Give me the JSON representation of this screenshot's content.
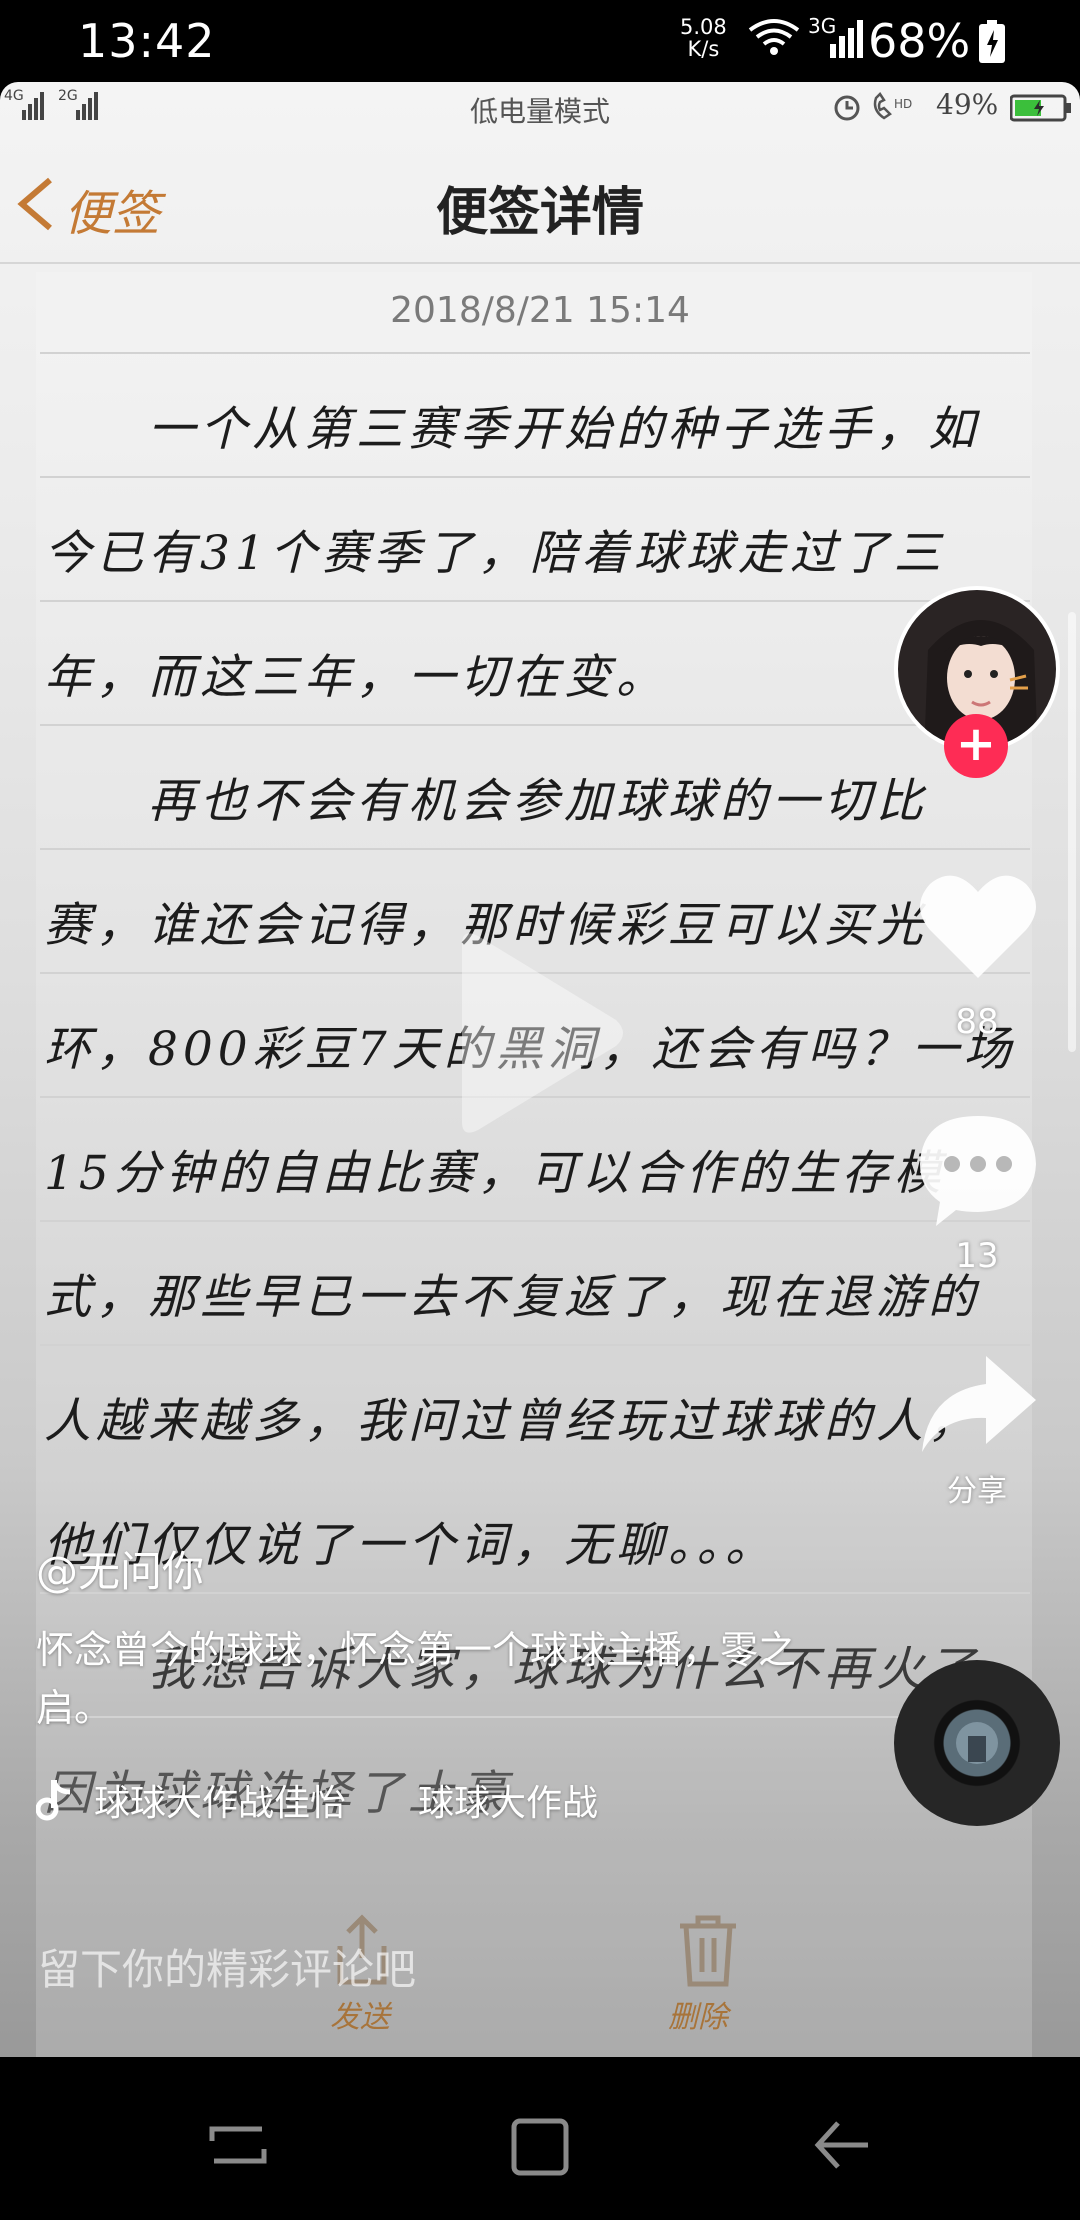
{
  "status_bar": {
    "time": "13:42",
    "network_speed_value": "5.08",
    "network_speed_unit": "K/s",
    "network_type": "3G",
    "battery_percent": "68%",
    "icons": [
      "wifi-icon",
      "signal-icon",
      "battery-icon"
    ]
  },
  "video": {
    "photo_status": {
      "signal_left": "4G",
      "signal_right": "2G",
      "mode_label": "低电量模式",
      "battery_percent": "49%",
      "icons": [
        "alarm-icon",
        "hd-call-icon"
      ]
    },
    "photo_header": {
      "back_label": "便签",
      "title": "便签详情"
    },
    "memo": {
      "date": "2018/8/21 15:14",
      "lines": [
        "　　一个从第三赛季开始的种子选手，如",
        "今已有31个赛季了，陪着球球走过了三",
        "年，而这三年，一切在变。",
        "　　再也不会有机会参加球球的一切比",
        "赛，谁还会记得，那时候彩豆可以买光",
        "环，800彩豆7天的黑洞，还会有吗？一场",
        "15分钟的自由比赛，可以合作的生存模",
        "式，那些早已一去不复返了，现在退游的",
        "人越来越多，我问过曾经玩过球球的人，",
        "他们仅仅说了一个词，无聊。。。",
        "　　我想告诉大家，球球为什么不再火了",
        "因为球球选择了土豪"
      ]
    },
    "photo_bottom": {
      "send_label": "发送",
      "delete_label": "删除"
    }
  },
  "actions": {
    "like_count": "88",
    "comment_count": "13",
    "share_label": "分享",
    "follow_symbol": "+"
  },
  "caption": {
    "author": "@无问你",
    "description": "怀念曾今的球球，怀念第一个球球主播，零之启。",
    "music": "球球大作战佳怡　　球球大作战"
  },
  "comment_placeholder": "留下你的精彩评论吧",
  "colors": {
    "follow": "#fe2c55",
    "memo_accent": "#c47a35"
  }
}
